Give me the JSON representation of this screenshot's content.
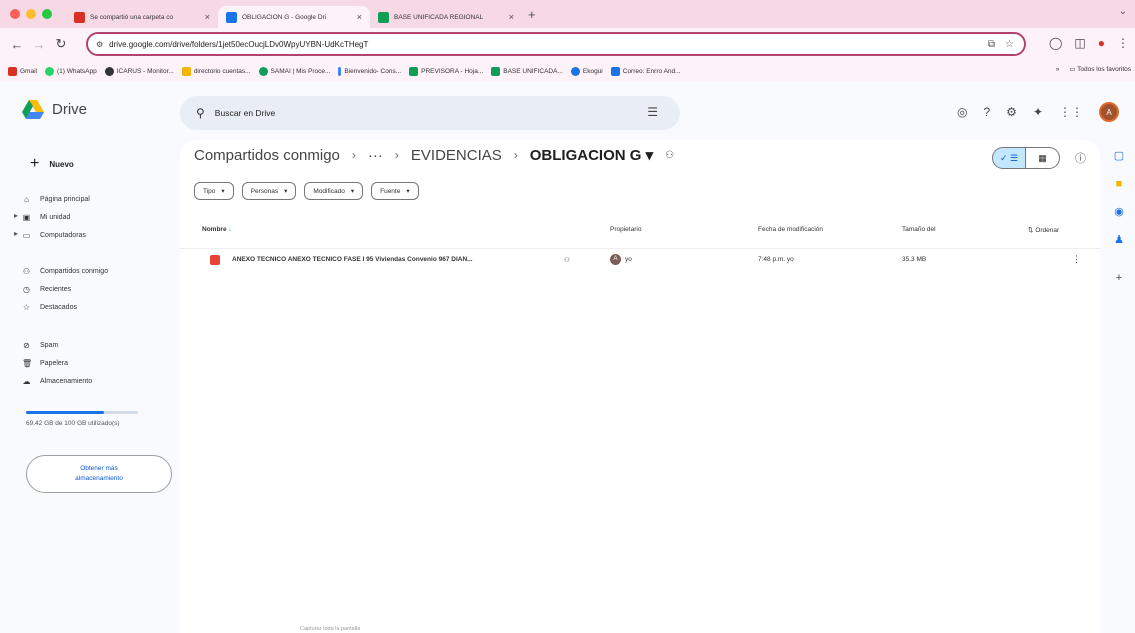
{
  "browser": {
    "tabs": [
      {
        "title": "Se compartió una carpeta co",
        "favicon_color": "#d93025"
      },
      {
        "title": "OBLIGACION G - Google Dri",
        "favicon_color": "#1a73e8"
      },
      {
        "title": "BASE UNIFICADA REGIONAL",
        "favicon_color": "#0f9d58"
      }
    ],
    "url": "drive.google.com/drive/folders/1jet50ecOucjLDv0WpyUYBN-UdKcTHegT",
    "bookmarks": [
      {
        "label": "Gmail",
        "color": "#d93025"
      },
      {
        "label": "(1) WhatsApp",
        "color": "#25d366"
      },
      {
        "label": "ICARUS - Monitor...",
        "color": "#333333"
      },
      {
        "label": "directorio cuentas...",
        "color": "#f4b400"
      },
      {
        "label": "SAMAI | Mis Proce...",
        "color": "#0f9d58"
      },
      {
        "label": "Bienvenido- Cons...",
        "color": "#4285f4"
      },
      {
        "label": "PREVISORA - Hoja...",
        "color": "#0f9d58"
      },
      {
        "label": "BASE UNIFICADA...",
        "color": "#0f9d58"
      },
      {
        "label": "Ekogui",
        "color": "#1a73e8"
      },
      {
        "label": "Correo: Enrro And...",
        "color": "#1a73e8"
      }
    ],
    "all_bookmarks": "Todos los favoritos"
  },
  "drive": {
    "app_name": "Drive",
    "search_placeholder": "Buscar en Drive",
    "avatar_letter": "A",
    "new_button": "Nuevo",
    "nav": [
      {
        "label": "Página principal",
        "icon": "home-icon",
        "glyph": "⌂"
      },
      {
        "label": "Mi unidad",
        "icon": "my-drive-icon",
        "glyph": "▣"
      },
      {
        "label": "Computadoras",
        "icon": "computer-icon",
        "glyph": "▭"
      },
      {
        "label": "Compartidos conmigo",
        "icon": "shared-icon",
        "glyph": "⚇"
      },
      {
        "label": "Recientes",
        "icon": "clock-icon",
        "glyph": "◷"
      },
      {
        "label": "Destacados",
        "icon": "star-icon",
        "glyph": "☆"
      },
      {
        "label": "Spam",
        "icon": "spam-icon",
        "glyph": "⊘"
      },
      {
        "label": "Papelera",
        "icon": "trash-icon",
        "glyph": "🗑"
      },
      {
        "label": "Almacenamiento",
        "icon": "cloud-icon",
        "glyph": "☁"
      }
    ],
    "storage_text": "69.42 GB de 100 GB utilizado(s)",
    "storage_fraction": 0.694,
    "get_more_button": "Obtener más almacenamiento",
    "breadcrumb": [
      "Compartidos conmigo",
      "···",
      "EVIDENCIAS",
      "OBLIGACION G ▾"
    ],
    "filters": [
      "Tipo",
      "Personas",
      "Modificado",
      "Fuente"
    ],
    "columns": {
      "name": "Nombre",
      "owner": "Propietario",
      "modified": "Fecha de modificación",
      "size": "Tamaño del",
      "sort": "Ordenar"
    },
    "files": [
      {
        "name": "ANEXO TECNICO ANEXO TECNICO FASE I 95 Viviendas Convenio 967 DIAN...",
        "owner": "yo",
        "owner_initial": "A",
        "modified": "7:48 p.m. yo",
        "size": "35.3 MB",
        "type": "pdf"
      }
    ],
    "footer_note": "Capturar toda la pantalla"
  }
}
